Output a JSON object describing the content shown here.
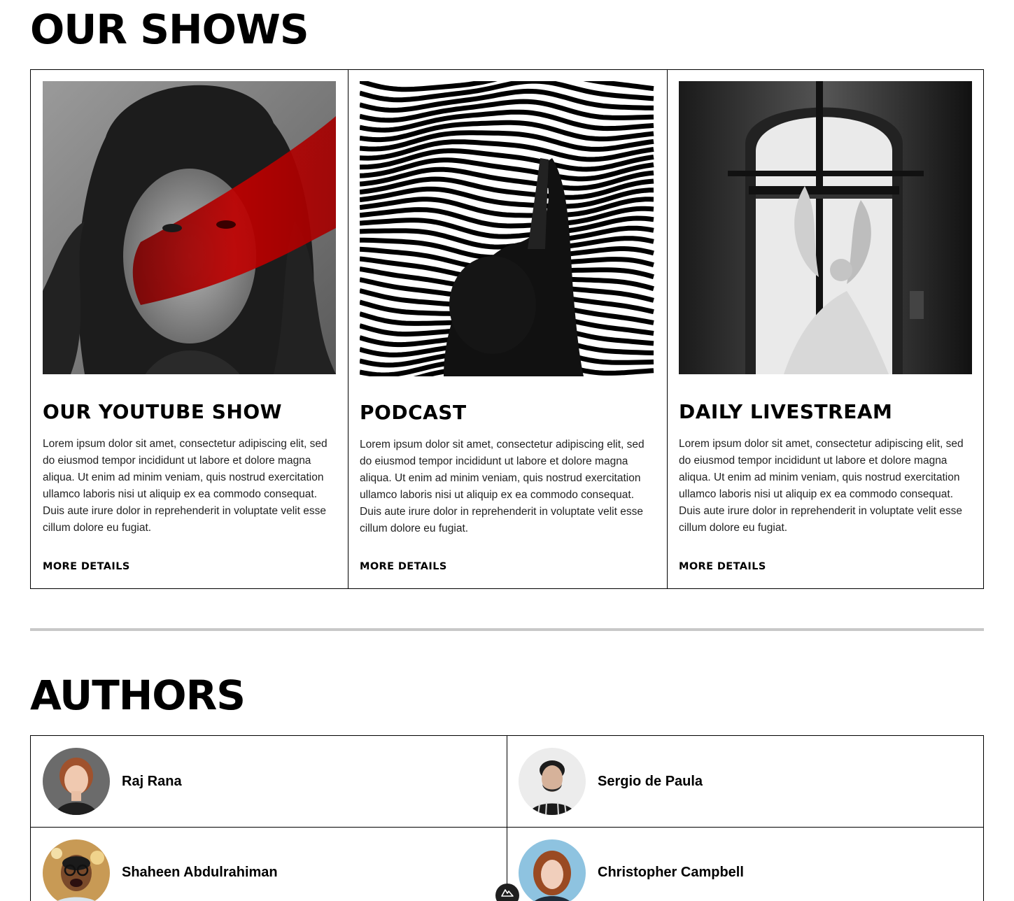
{
  "shows": {
    "title": "OUR SHOWS",
    "cards": [
      {
        "title": "OUR YOUTUBE SHOW",
        "image": "woman-with-red-paint-photo",
        "text": "Lorem ipsum dolor sit amet, consectetur adipiscing elit, sed do eiusmod tempor incididunt ut labore et dolore magna aliqua. Ut enim ad minim veniam, quis nostrud exercitation ullamco laboris nisi ut aliquip ex ea commodo consequat. Duis aute irure dolor in reprehenderit in voluptate velit esse cillum dolore eu fugiat.",
        "link": "MORE DETAILS"
      },
      {
        "title": "PODCAST",
        "image": "striped-wave-figure-photo",
        "text": "Lorem ipsum dolor sit amet, consectetur adipiscing elit, sed do eiusmod tempor incididunt ut labore et dolore magna aliqua. Ut enim ad minim veniam, quis nostrud exercitation ullamco laboris nisi ut aliquip ex ea commodo consequat. Duis aute irure dolor in reprehenderit in voluptate velit esse cillum dolore eu fugiat.",
        "link": "MORE DETAILS"
      },
      {
        "title": "DAILY LIVESTREAM",
        "image": "angel-statue-window-photo",
        "text": "Lorem ipsum dolor sit amet, consectetur adipiscing elit, sed do eiusmod tempor incididunt ut labore et dolore magna aliqua. Ut enim ad minim veniam, quis nostrud exercitation ullamco laboris nisi ut aliquip ex ea commodo consequat. Duis aute irure dolor in reprehenderit in voluptate velit esse cillum dolore eu fugiat.",
        "link": "MORE DETAILS"
      }
    ]
  },
  "authors": {
    "title": "AUTHORS",
    "items": [
      {
        "name": "Raj Rana",
        "avatar": "red-haired-woman-avatar"
      },
      {
        "name": "Sergio de Paula",
        "avatar": "bearded-man-avatar"
      },
      {
        "name": "Shaheen Abdulrahiman",
        "avatar": "man-with-glasses-avatar"
      },
      {
        "name": "Christopher Campbell",
        "avatar": "red-haired-woman-blue-bg-avatar"
      }
    ]
  },
  "badge_icon": "nuxt-logo-icon",
  "colors": {
    "accent_red": "#b00000",
    "divider": "#c8c8c8",
    "border": "#000000"
  }
}
